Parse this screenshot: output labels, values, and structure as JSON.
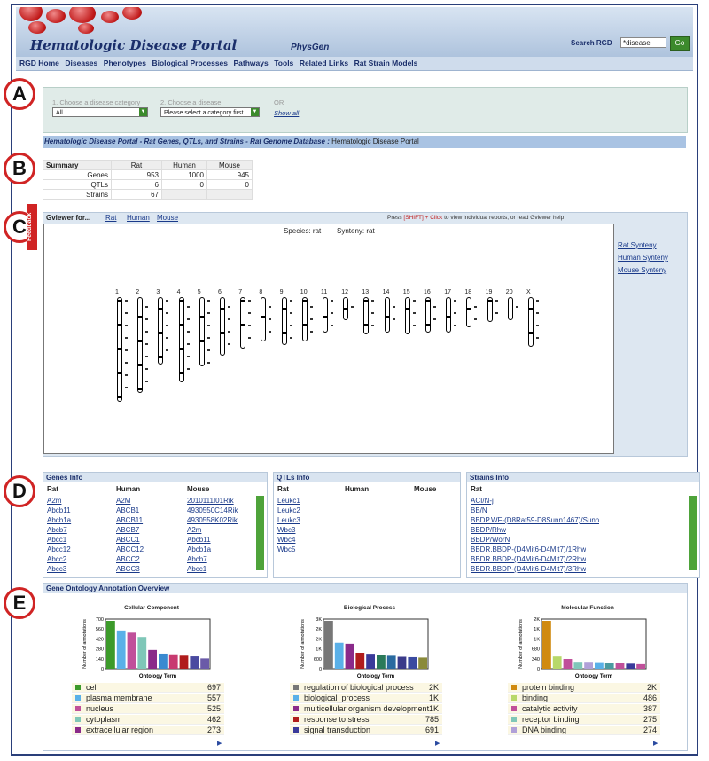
{
  "header": {
    "title": "Hematologic Disease Portal",
    "partner": "PhysGen",
    "search_label": "Search RGD",
    "search_value": "*disease",
    "go_label": "Go"
  },
  "nav": [
    "RGD Home",
    "Diseases",
    "Phenotypes",
    "Biological Processes",
    "Pathways",
    "Tools",
    "Related Links",
    "Rat Strain Models"
  ],
  "badges": [
    "A",
    "B",
    "C",
    "D",
    "E"
  ],
  "chooser": {
    "step1": "1. Choose a disease category",
    "step1_value": "All",
    "step2": "2. Choose a disease",
    "step2_value": "Please select a category first",
    "or": "OR",
    "show_all": "Show all"
  },
  "breadcrumb": {
    "main": "Hematologic Disease Portal - Rat Genes, QTLs, and Strains - Rat Genome Database :",
    "tail": "Hematologic Disease Portal"
  },
  "summary": {
    "title": "Summary",
    "cols": [
      "Rat",
      "Human",
      "Mouse"
    ],
    "rows": [
      {
        "label": "Genes",
        "vals": [
          "953",
          "1000",
          "945"
        ]
      },
      {
        "label": "QTLs",
        "vals": [
          "6",
          "0",
          "0"
        ]
      },
      {
        "label": "Strains",
        "vals": [
          "67",
          "",
          ""
        ]
      }
    ]
  },
  "gviewer": {
    "label": "Gviewer for...",
    "species_links": [
      "Rat",
      "Human",
      "Mouse"
    ],
    "hint_pre": "Press ",
    "hint_key": "[SHIFT] + Click",
    "hint_post": " to view individual reports, or read Gviewer help",
    "species": "Species: rat",
    "synteny": "Synteny: rat",
    "chromosomes": [
      "1",
      "2",
      "3",
      "4",
      "5",
      "6",
      "7",
      "8",
      "9",
      "10",
      "11",
      "12",
      "13",
      "14",
      "15",
      "16",
      "17",
      "18",
      "19",
      "20",
      "X"
    ],
    "side_links": [
      "Rat Synteny",
      "Human Synteny",
      "Mouse Synteny"
    ]
  },
  "feedback": "Feedback",
  "genes_info": {
    "title": "Genes Info",
    "cols": [
      "Rat",
      "Human",
      "Mouse"
    ],
    "rows": [
      [
        "A2m",
        "A2M",
        "2010111I01Rik"
      ],
      [
        "Abcb11",
        "ABCB1",
        "4930550C14Rik"
      ],
      [
        "Abcb1a",
        "ABCB11",
        "4930558K02Rik"
      ],
      [
        "Abcb7",
        "ABCB7",
        "A2m"
      ],
      [
        "Abcc1",
        "ABCC1",
        "Abcb11"
      ],
      [
        "Abcc12",
        "ABCC12",
        "Abcb1a"
      ],
      [
        "Abcc2",
        "ABCC2",
        "Abcb7"
      ],
      [
        "Abcc3",
        "ABCC3",
        "Abcc1"
      ]
    ]
  },
  "qtls_info": {
    "title": "QTLs Info",
    "cols": [
      "Rat",
      "Human",
      "Mouse"
    ],
    "rows": [
      "Leukc1",
      "Leukc2",
      "Leukc3",
      "Wbc3",
      "Wbc4",
      "Wbc5"
    ]
  },
  "strains_info": {
    "title": "Strains Info",
    "col": "Rat",
    "rows": [
      "ACI/N-j",
      "BB/N",
      "BBDP.WF-(D8Rat59-D8Sunn1467)/Sunn",
      "BBDP/Rhw",
      "BBDP/WorN",
      "BBDR.BBDP-(D4Mit6-D4Mit7)/1Rhw",
      "BBDR.BBDP-(D4Mit6-D4Mit7)/2Rhw",
      "BBDR.BBDP-(D4Mit6-D4Mit7)/3Rhw"
    ]
  },
  "go_overview": {
    "title": "Gene Ontology Annotation Overview",
    "xlabel": "Ontology Term",
    "ylabel": "Number of annotations"
  },
  "chart_data": [
    {
      "type": "bar",
      "title": "Cellular Component",
      "ticks": [
        "0",
        "140",
        "280",
        "420",
        "560",
        "700"
      ],
      "values": [
        697,
        557,
        525,
        462,
        273,
        220,
        210,
        190,
        180,
        150
      ],
      "colors": [
        "#3c9a2a",
        "#5ab0e8",
        "#c0509a",
        "#7fc7b8",
        "#8a2a8a",
        "#3a8ad0",
        "#c83a70",
        "#b01c1c",
        "#4a4aa0",
        "#6a5aa8"
      ],
      "legend": [
        {
          "name": "cell",
          "count": "697"
        },
        {
          "name": "plasma membrane",
          "count": "557"
        },
        {
          "name": "nucleus",
          "count": "525"
        },
        {
          "name": "cytoplasm",
          "count": "462"
        },
        {
          "name": "extracellular region",
          "count": "273"
        }
      ]
    },
    {
      "type": "bar",
      "title": "Biological Process",
      "ticks": [
        "0",
        "600",
        "1K",
        "2K",
        "2K",
        "3K"
      ],
      "values": [
        2400,
        1300,
        1250,
        800,
        750,
        700,
        650,
        600,
        580,
        560
      ],
      "colors": [
        "#777777",
        "#5ab0e8",
        "#8a2a8a",
        "#b01c1c",
        "#3a3a9a",
        "#2a7a5a",
        "#2a6aa0",
        "#3a3a8a",
        "#3a4aa0",
        "#8a8a3a"
      ],
      "legend": [
        {
          "name": "regulation of biological process",
          "count": "2K"
        },
        {
          "name": "biological_process",
          "count": "1K"
        },
        {
          "name": "multicellular organism development",
          "count": "1K"
        },
        {
          "name": "response to stress",
          "count": "785"
        },
        {
          "name": "signal transduction",
          "count": "691"
        }
      ]
    },
    {
      "type": "bar",
      "title": "Molecular Function",
      "ticks": [
        "0",
        "340",
        "680",
        "1K",
        "1K",
        "2K"
      ],
      "values": [
        1900,
        486,
        387,
        275,
        274,
        260,
        240,
        220,
        200,
        180
      ],
      "colors": [
        "#d08a10",
        "#b7d86a",
        "#c0509a",
        "#7fc7b8",
        "#b0a0d8",
        "#5ab0e8",
        "#4a9aa0",
        "#c0509a",
        "#3a3a9a",
        "#c0509a"
      ],
      "legend": [
        {
          "name": "protein binding",
          "count": "2K"
        },
        {
          "name": "binding",
          "count": "486"
        },
        {
          "name": "catalytic activity",
          "count": "387"
        },
        {
          "name": "receptor binding",
          "count": "275"
        },
        {
          "name": "DNA binding",
          "count": "274"
        }
      ]
    }
  ]
}
